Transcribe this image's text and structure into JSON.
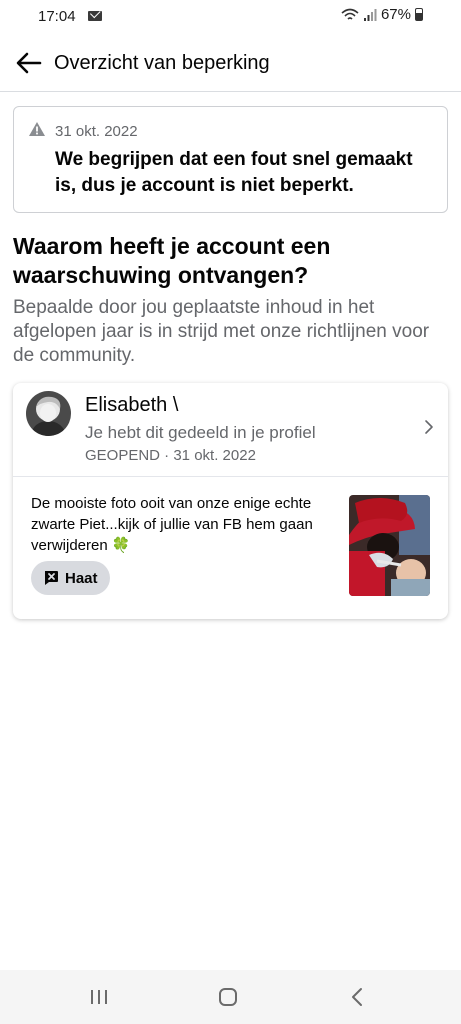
{
  "status_bar": {
    "time": "17:04",
    "battery": "67%"
  },
  "header": {
    "title": "Overzicht van beperking"
  },
  "notice": {
    "date": "31 okt. 2022",
    "message": "We begrijpen dat een fout snel gemaakt is, dus je account is niet beperkt."
  },
  "section": {
    "heading": "Waarom heeft je account een waarschuwing ontvangen?",
    "description": "Bepaalde door jou geplaatste inhoud in het afgelopen jaar is in strijd met onze richtlijnen voor de community."
  },
  "post": {
    "author": "Elisabeth \\",
    "shared_text": "Je hebt dit gedeeld in je profiel",
    "opened_text": "GEOPEND · 31 okt. 2022",
    "body": "De mooiste foto ooit van onze enige echte zwarte Piet...kijk of jullie van FB hem gaan verwijderen",
    "emoji": "🍀",
    "reaction_label": "Haat"
  },
  "icons": {
    "back": "arrow-left-icon",
    "warning": "warning-triangle-icon",
    "chevron": "chevron-right-icon",
    "reaction": "hate-speech-icon"
  },
  "colors": {
    "text": "#050505",
    "secondary": "#65676b",
    "border": "#ced0d4",
    "pill": "#d8dadf"
  }
}
